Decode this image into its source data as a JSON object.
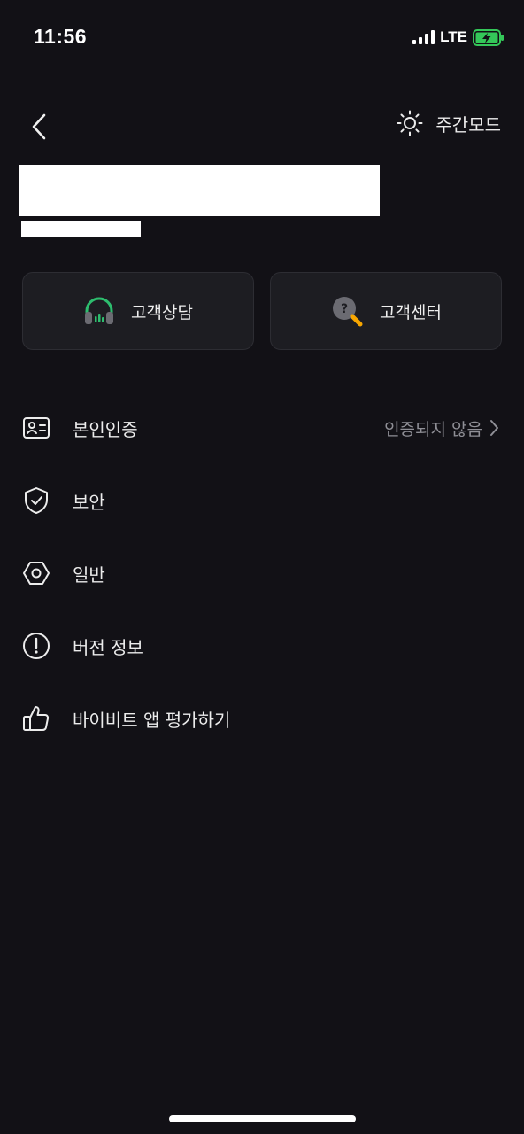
{
  "status_bar": {
    "time": "11:56",
    "network": "LTE",
    "battery_color": "#34c759"
  },
  "header": {
    "back_icon": "chevron-left-icon",
    "day_mode_label": "주간모드",
    "day_mode_icon": "sun-icon"
  },
  "support": {
    "consult_label": "고객상담",
    "consult_icon": "headset-icon",
    "center_label": "고객센터",
    "center_icon": "help-search-icon"
  },
  "menu": {
    "items": [
      {
        "label": "본인인증",
        "icon": "id-card-icon",
        "value": "인증되지 않음"
      },
      {
        "label": "보안",
        "icon": "shield-check-icon"
      },
      {
        "label": "일반",
        "icon": "hexagon-settings-icon"
      },
      {
        "label": "버전 정보",
        "icon": "info-circle-icon"
      },
      {
        "label": "바이비트 앱 평가하기",
        "icon": "thumbs-up-icon"
      }
    ]
  },
  "colors": {
    "background": "#121116",
    "card_background": "#1d1d22",
    "accent_green": "#2dbd6e",
    "accent_orange": "#f7a600",
    "muted_text": "#8f8f96"
  }
}
